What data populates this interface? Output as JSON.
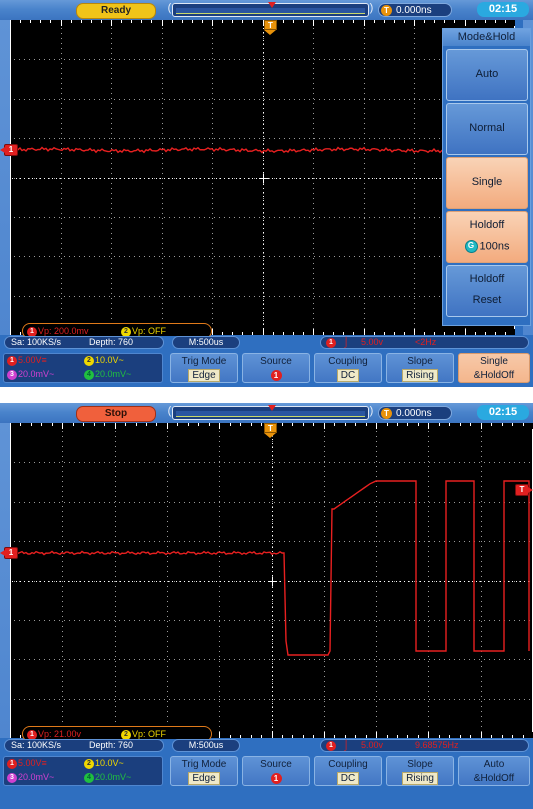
{
  "screenshots": [
    {
      "id": "scope-top",
      "topbar": {
        "run_status": "Ready",
        "trigger_time": "0.000ns",
        "clock": "02:15",
        "trigger_badge": "T"
      },
      "trigger_marker_label": "T",
      "channel_marker_label": "1",
      "measure": {
        "m1": "Vp: 200.0mv",
        "m2": "Vp: OFF",
        "m1_num": "1",
        "m2_num": "2"
      },
      "info": {
        "sample_rate": "Sa: 100KS/s",
        "depth": "Depth: 760",
        "timebase": "M:500us",
        "trig_source_num": "1",
        "trig_slope_icon": "rising-edge",
        "trig_level": "5.00v",
        "trig_freq": "<2Hz"
      },
      "channels": [
        {
          "num": "1",
          "label": "5.00V",
          "coupling_glyph": "DC",
          "color": "#e02020"
        },
        {
          "num": "2",
          "label": "10.0V",
          "coupling_glyph": "AC",
          "color": "#f0d800"
        },
        {
          "num": "3",
          "label": "20.0mV",
          "coupling_glyph": "AC",
          "color": "#d040d0"
        },
        {
          "num": "4",
          "label": "20.0mV",
          "coupling_glyph": "AC",
          "color": "#20c040"
        }
      ],
      "bottom_menu": [
        {
          "title": "Trig Mode",
          "value": "Edge",
          "highlight": true,
          "selected": false
        },
        {
          "title": "Source",
          "value": "1",
          "is_dot": true,
          "selected": false
        },
        {
          "title": "Coupling",
          "value": "DC",
          "highlight": true,
          "selected": false
        },
        {
          "title": "Slope",
          "value": "Rising",
          "highlight": true,
          "selected": false
        },
        {
          "title": "Single",
          "value": "&HoldOff",
          "highlight": false,
          "selected": true
        }
      ],
      "side_menu": {
        "title": "Mode&Hold",
        "items": [
          {
            "l1": "Auto",
            "l2": "",
            "active": false
          },
          {
            "l1": "Normal",
            "l2": "",
            "active": false
          },
          {
            "l1": "Single",
            "l2": "",
            "active": true
          },
          {
            "l1": "Holdoff",
            "l2": "100ns",
            "active": true,
            "badge": "G"
          },
          {
            "l1": "Holdoff",
            "l2": "Reset",
            "active": false
          }
        ]
      },
      "waveform": "flat-dc-line"
    },
    {
      "id": "scope-bottom",
      "topbar": {
        "run_status": "Stop",
        "trigger_time": "0.000ns",
        "clock": "02:15",
        "trigger_badge": "T"
      },
      "trigger_marker_label": "T",
      "channel_marker_label": "1",
      "measure": {
        "m1": "Vp: 21.00v",
        "m2": "Vp: OFF",
        "m1_num": "1",
        "m2_num": "2"
      },
      "info": {
        "sample_rate": "Sa: 100KS/s",
        "depth": "Depth: 760",
        "timebase": "M:500us",
        "trig_source_num": "1",
        "trig_slope_icon": "rising-edge",
        "trig_level": "5.00v",
        "trig_freq": "9.68575Hz"
      },
      "channels": [
        {
          "num": "1",
          "label": "5.00V",
          "coupling_glyph": "DC",
          "color": "#e02020"
        },
        {
          "num": "2",
          "label": "10.0V",
          "coupling_glyph": "AC",
          "color": "#f0d800"
        },
        {
          "num": "3",
          "label": "20.0mV",
          "coupling_glyph": "AC",
          "color": "#d040d0"
        },
        {
          "num": "4",
          "label": "20.0mV",
          "coupling_glyph": "AC",
          "color": "#20c040"
        }
      ],
      "bottom_menu": [
        {
          "title": "Trig Mode",
          "value": "Edge",
          "highlight": true,
          "selected": false
        },
        {
          "title": "Source",
          "value": "1",
          "is_dot": true,
          "selected": false
        },
        {
          "title": "Coupling",
          "value": "DC",
          "highlight": true,
          "selected": false
        },
        {
          "title": "Slope",
          "value": "Rising",
          "highlight": true,
          "selected": false
        },
        {
          "title": "Auto",
          "value": "&HoldOff",
          "highlight": false,
          "selected": false
        }
      ],
      "waveform": "square-burst"
    }
  ],
  "colors": {
    "panel_blue": "#2f6fc0",
    "screen_black": "#000000",
    "trace_red": "#e02020",
    "accent_orange": "#f4b68d",
    "ready_yellow": "#f0c419",
    "stop_red": "#f0603c"
  }
}
